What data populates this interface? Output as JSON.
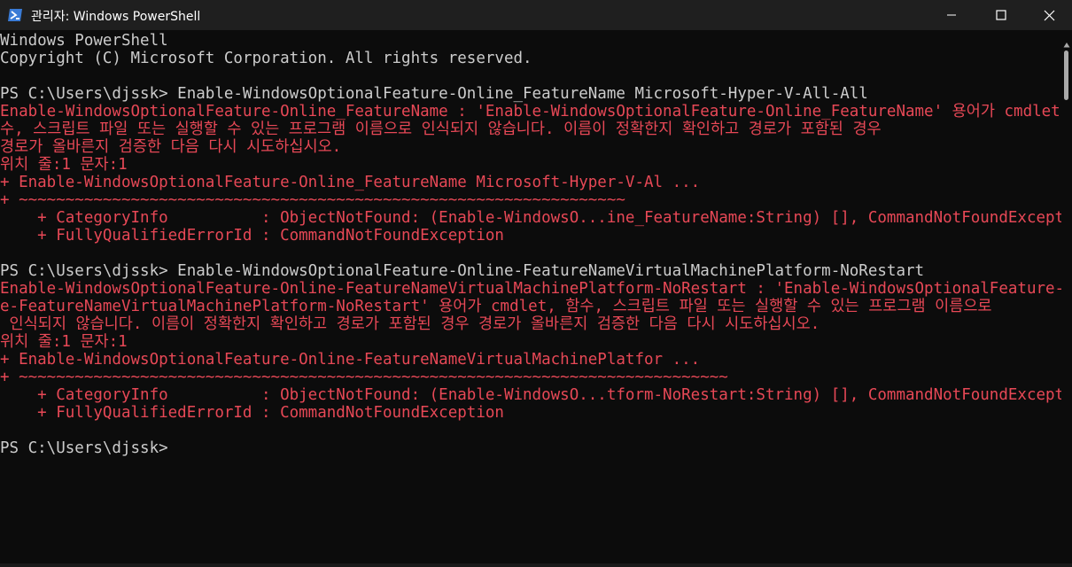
{
  "window": {
    "title": "관리자: Windows PowerShell",
    "minimize_icon": "minimize-icon",
    "maximize_icon": "maximize-icon",
    "close_icon": "close-icon",
    "app_icon": "powershell-icon"
  },
  "colors": {
    "background": "#0c0c0c",
    "titlebar": "#1f1f1f",
    "text_normal": "#cccccc",
    "text_error": "#e74856"
  },
  "terminal": {
    "lines": [
      "Windows PowerShell",
      "Copyright (C) Microsoft Corporation. All rights reserved.",
      "",
      "PS C:\\Users\\djssk> Enable-WindowsOptionalFeature-Online_FeatureName Microsoft-Hyper-V-All-All",
      "Enable-WindowsOptionalFeature-Online_FeatureName : 'Enable-WindowsOptionalFeature-Online_FeatureName' 용어가 cmdlet, 함",
      "수, 스크립트 파일 또는 실행할 수 있는 프로그램 이름으로 인식되지 않습니다. 이름이 정확한지 확인하고 경로가 포함된 경우",
      "경로가 올바른지 검증한 다음 다시 시도하십시오.",
      "위치 줄:1 문자:1",
      "+ Enable-WindowsOptionalFeature-Online_FeatureName Microsoft-Hyper-V-Al ...",
      "+ ~~~~~~~~~~~~~~~~~~~~~~~~~~~~~~~~~~~~~~~~~~~~~~~~~~~~~~~~~~~~~~~~~",
      "    + CategoryInfo          : ObjectNotFound: (Enable-WindowsO...ine_FeatureName:String) [], CommandNotFoundException",
      "    + FullyQualifiedErrorId : CommandNotFoundException",
      "",
      "PS C:\\Users\\djssk> Enable-WindowsOptionalFeature-Online-FeatureNameVirtualMachinePlatform-NoRestart",
      "Enable-WindowsOptionalFeature-Online-FeatureNameVirtualMachinePlatform-NoRestart : 'Enable-WindowsOptionalFeature-Onlin",
      "e-FeatureNameVirtualMachinePlatform-NoRestart' 용어가 cmdlet, 함수, 스크립트 파일 또는 실행할 수 있는 프로그램 이름으로",
      " 인식되지 않습니다. 이름이 정확한지 확인하고 경로가 포함된 경우 경로가 올바른지 검증한 다음 다시 시도하십시오.",
      "위치 줄:1 문자:1",
      "+ Enable-WindowsOptionalFeature-Online-FeatureNameVirtualMachinePlatfor ...",
      "+ ~~~~~~~~~~~~~~~~~~~~~~~~~~~~~~~~~~~~~~~~~~~~~~~~~~~~~~~~~~~~~~~~~~~~~~~~~~~~",
      "    + CategoryInfo          : ObjectNotFound: (Enable-WindowsO...tform-NoRestart:String) [], CommandNotFoundException",
      "    + FullyQualifiedErrorId : CommandNotFoundException",
      "",
      "PS C:\\Users\\djssk>"
    ]
  },
  "scrollbar": {
    "up_icon": "scroll-up-arrow-icon"
  }
}
